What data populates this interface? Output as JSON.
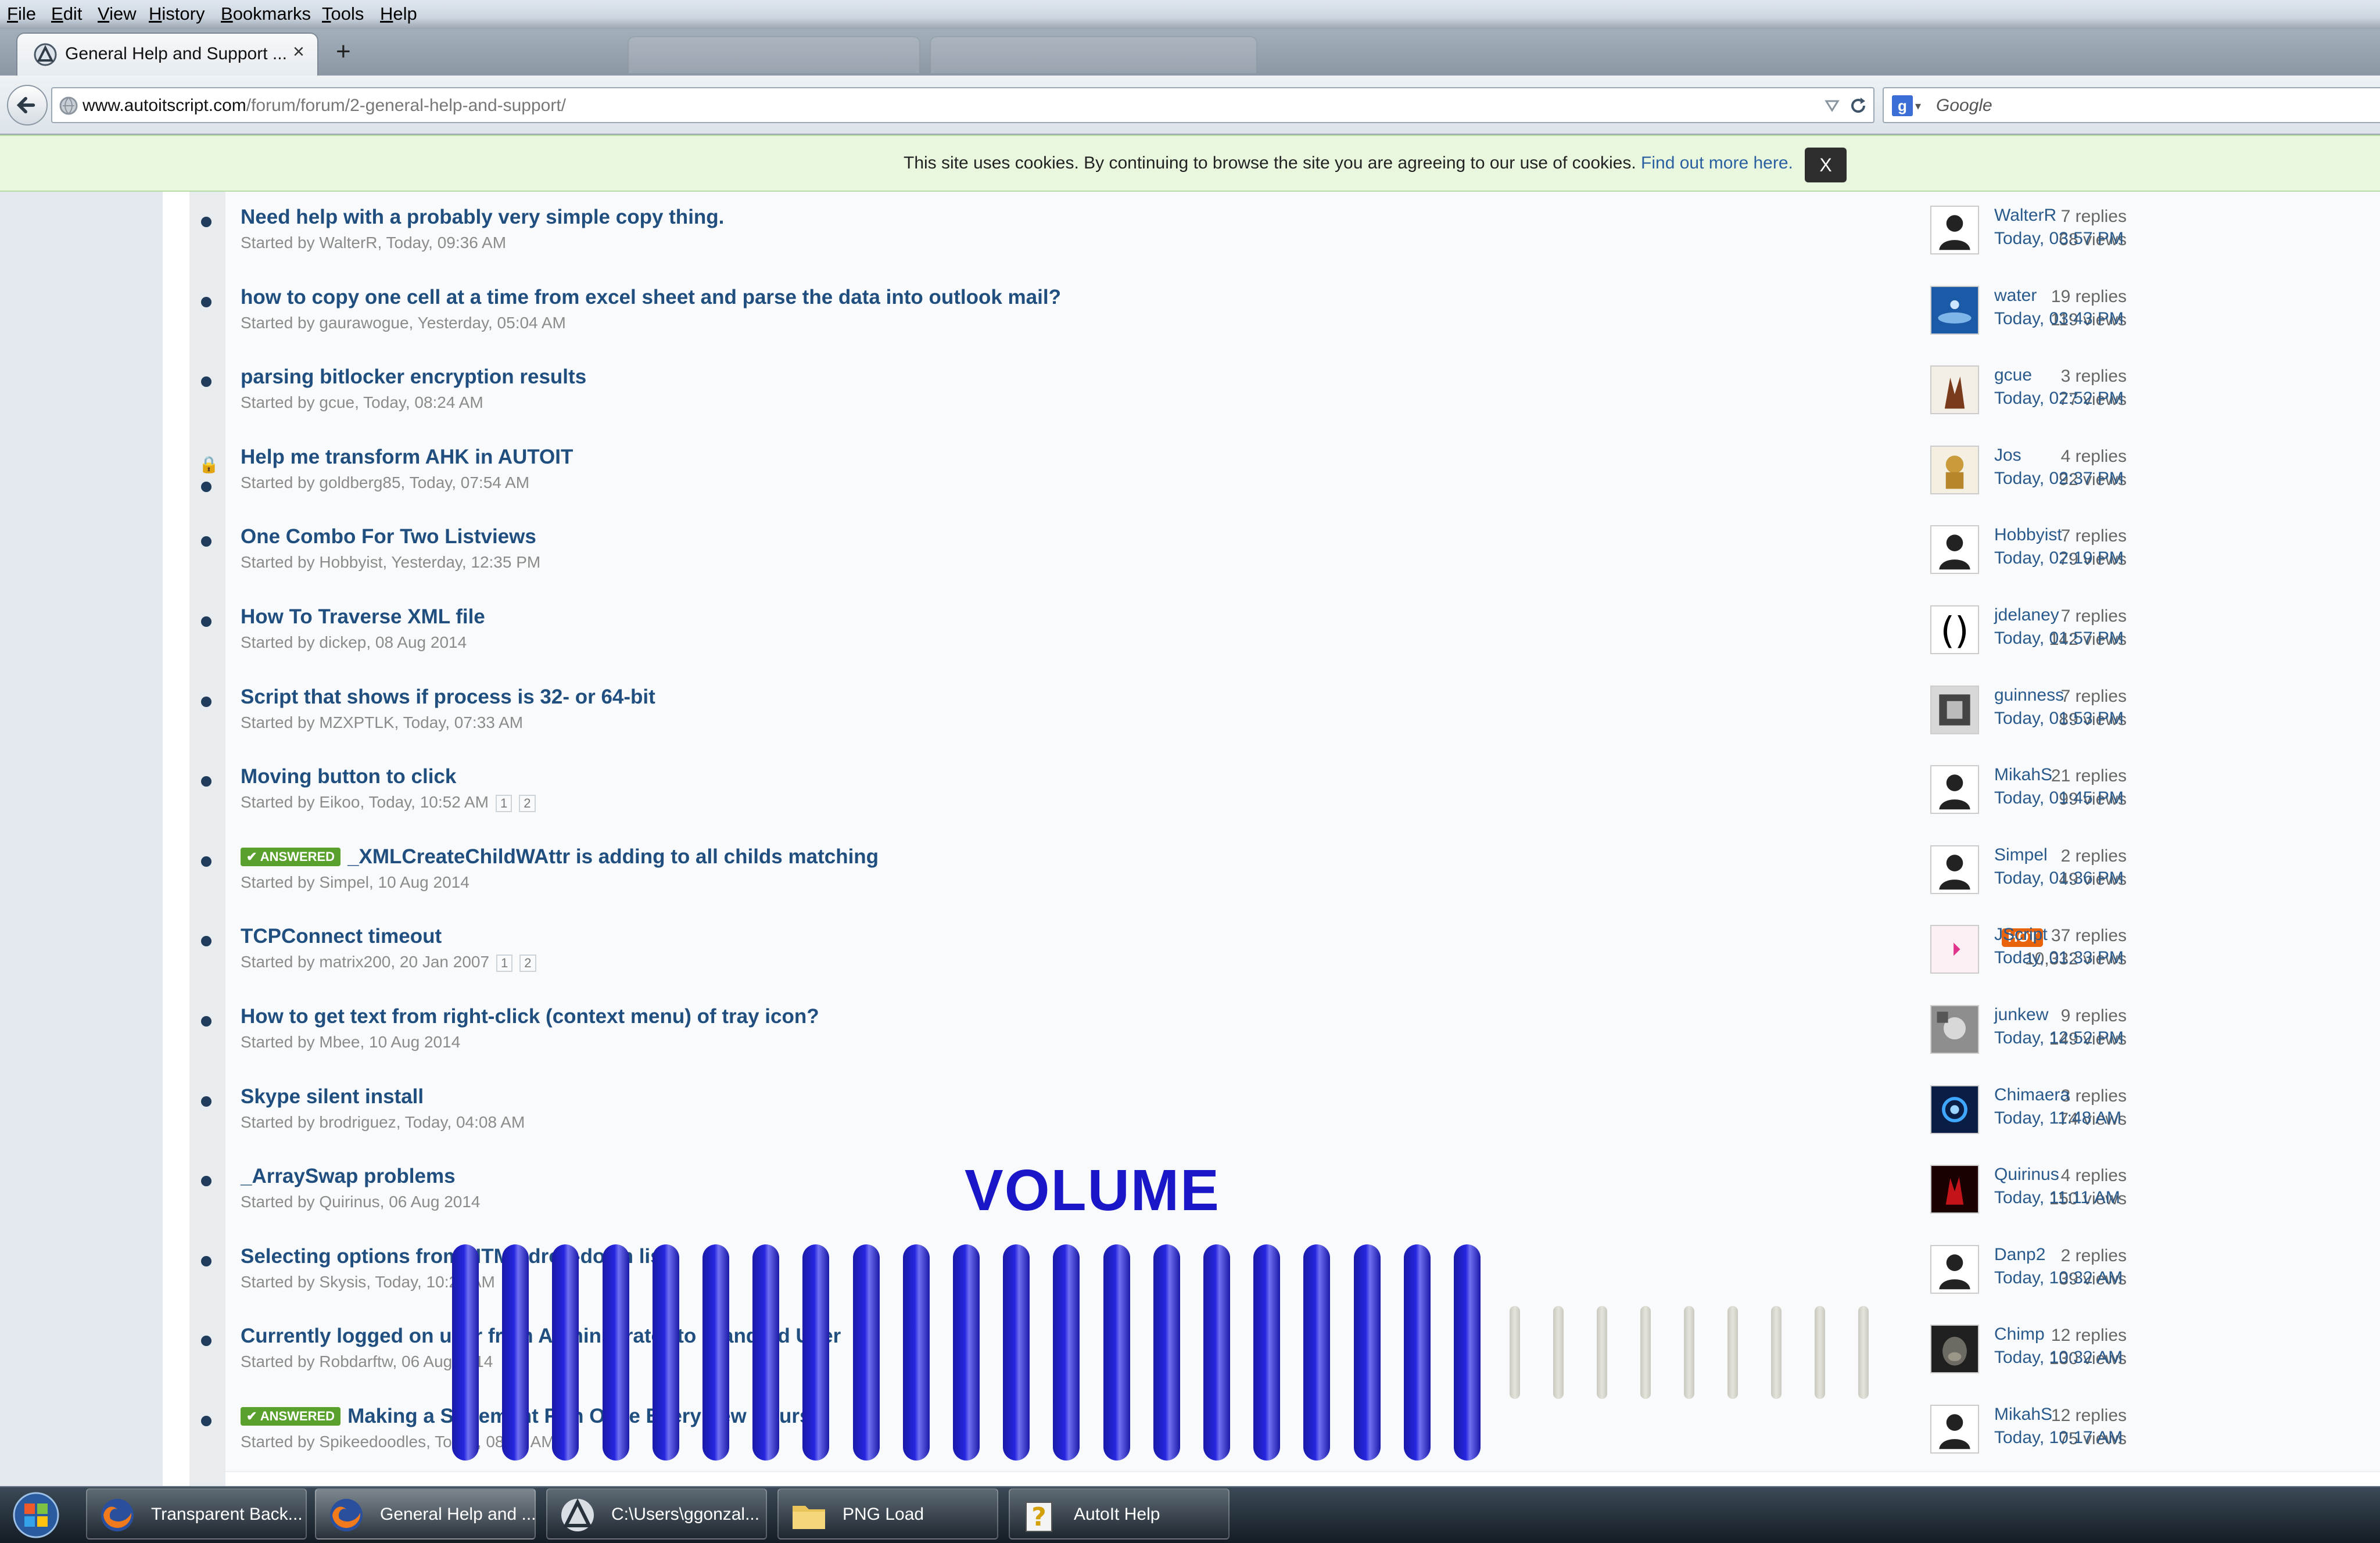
{
  "menu": [
    "File",
    "Edit",
    "View",
    "History",
    "Bookmarks",
    "Tools",
    "Help"
  ],
  "tab": {
    "title": "General Help and Support ...",
    "close": "×",
    "new_tab": "+"
  },
  "address": {
    "host": "www.autoitscript.com",
    "path": "/forum/forum/2-general-help-and-support/"
  },
  "search": {
    "placeholder": "Google"
  },
  "cookie": {
    "text": "This site uses cookies. By continuing to browse the site you are agreeing to our use of cookies.",
    "link": "Find out more here.",
    "close": "X"
  },
  "topics": [
    {
      "title": "Need help with a probably very simple copy thing.",
      "meta": "Started by WalterR, Today, 09:36 AM",
      "replies": "7 replies",
      "views": "68 views",
      "user": "WalterR",
      "time": "Today, 03:57 PM"
    },
    {
      "title": "how to copy one cell at a time from excel sheet and parse the data into outlook mail?",
      "meta": "Started by gaurawogue, Yesterday, 05:04 AM",
      "replies": "19 replies",
      "views": "119 views",
      "user": "water",
      "time": "Today, 03:43 PM"
    },
    {
      "title": "parsing bitlocker encryption results",
      "meta": "Started by gcue, Today, 08:24 AM",
      "replies": "3 replies",
      "views": "77 views",
      "user": "gcue",
      "time": "Today, 02:52 PM"
    },
    {
      "title": "Help me transform AHK in AUTOIT",
      "meta": "Started by goldberg85, Today, 07:54 AM",
      "replies": "4 replies",
      "views": "92 views",
      "user": "Jos",
      "time": "Today, 02:37 PM",
      "locked": true
    },
    {
      "title": "One Combo For Two Listviews",
      "meta": "Started by Hobbyist, Yesterday, 12:35 PM",
      "replies": "7 replies",
      "views": "79 views",
      "user": "Hobbyist",
      "time": "Today, 02:19 PM"
    },
    {
      "title": "How To Traverse XML file",
      "meta": "Started by dickep, 08 Aug 2014",
      "replies": "7 replies",
      "views": "142 views",
      "user": "jdelaney",
      "time": "Today, 01:57 PM"
    },
    {
      "title": "Script that shows if process is 32- or 64-bit",
      "meta": "Started by MZXPTLK, Today, 07:33 AM",
      "replies": "7 replies",
      "views": "89 views",
      "user": "guinness",
      "time": "Today, 01:53 PM"
    },
    {
      "title": "Moving button to click",
      "meta": "Started by Eikoo, Today, 10:52 AM",
      "pages": [
        "1",
        "2"
      ],
      "replies": "21 replies",
      "views": "99 views",
      "user": "MikahS",
      "time": "Today, 01:45 PM"
    },
    {
      "title": "_XMLCreateChildWAttr is adding to all childs matching",
      "meta": "Started by Simpel, 10 Aug 2014",
      "answered": "✔ ANSWERED",
      "replies": "2 replies",
      "views": "49 views",
      "user": "Simpel",
      "time": "Today, 01:36 PM"
    },
    {
      "title": "TCPConnect timeout",
      "meta": "Started by matrix200, 20 Jan 2007",
      "pages": [
        "1",
        "2"
      ],
      "hot": "HOT",
      "replies": "37 replies",
      "views": "10,332 views",
      "user": "JScript",
      "time": "Today, 01:33 PM"
    },
    {
      "title": "How to get text from right-click (context menu) of tray icon?",
      "meta": "Started by Mbee, 10 Aug 2014",
      "replies": "9 replies",
      "views": "149 views",
      "user": "junkew",
      "time": "Today, 12:52 PM"
    },
    {
      "title": "Skype silent install",
      "meta": "Started by brodriguez, Today, 04:08 AM",
      "replies": "3 replies",
      "views": "74 views",
      "user": "Chimaera",
      "time": "Today, 11:48 AM"
    },
    {
      "title": "_ArraySwap problems",
      "meta": "Started by Quirinus, 06 Aug 2014",
      "replies": "4 replies",
      "views": "150 views",
      "user": "Quirinus",
      "time": "Today, 11:11 AM"
    },
    {
      "title": "Selecting options from HTML drop-down list.",
      "meta": "Started by Skysis, Today, 10:22 AM",
      "replies": "2 replies",
      "views": "39 views",
      "user": "Danp2",
      "time": "Today, 10:32 AM"
    },
    {
      "title": "Currently logged on user from Administrator to Standard User",
      "meta": "Started by Robdarftw, 06 Aug 2014",
      "replies": "12 replies",
      "views": "130 views",
      "user": "Chimp",
      "time": "Today, 10:32 AM"
    },
    {
      "title": "Making a Statement Run Once Every Few Hours",
      "meta": "Started by Spikeedoodles, Today, 08:37 AM",
      "answered": "✔ ANSWERED",
      "replies": "12 replies",
      "views": "75 views",
      "user": "MikahS",
      "time": "Today, 10:17 AM"
    }
  ],
  "volume": {
    "label": "VOLUME",
    "level_filled": 21,
    "level_total": 30,
    "filled_color": "#2626e0",
    "empty_color": "#e4e4dc"
  },
  "taskbar": [
    {
      "label": "Transparent Back...",
      "icon": "firefox-icon"
    },
    {
      "label": "General Help and ...",
      "icon": "firefox-icon",
      "active": true
    },
    {
      "label": "C:\\Users\\ggonzal...",
      "icon": "autoit-icon"
    },
    {
      "label": "PNG Load",
      "icon": "folder-icon"
    },
    {
      "label": "AutoIt Help",
      "icon": "help-icon"
    }
  ]
}
